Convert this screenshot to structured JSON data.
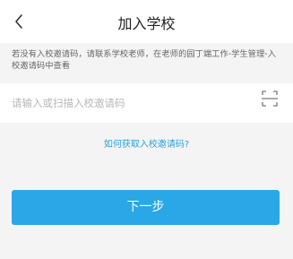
{
  "header": {
    "title": "加入学校",
    "back_icon": "chevron-left-icon"
  },
  "notice": {
    "text": "若没有入校邀请码，请联系学校老师，在老师的园丁端工作-学生管理-入校邀请码中查看"
  },
  "code_input": {
    "placeholder": "请输入或扫描入校邀请码",
    "value": "",
    "scan_icon": "scan-icon"
  },
  "help": {
    "link_label": "如何获取入校邀请码?"
  },
  "actions": {
    "next_label": "下一步"
  },
  "colors": {
    "accent": "#2aa7e6",
    "link": "#2ba3de",
    "background": "#f4f4f4"
  }
}
